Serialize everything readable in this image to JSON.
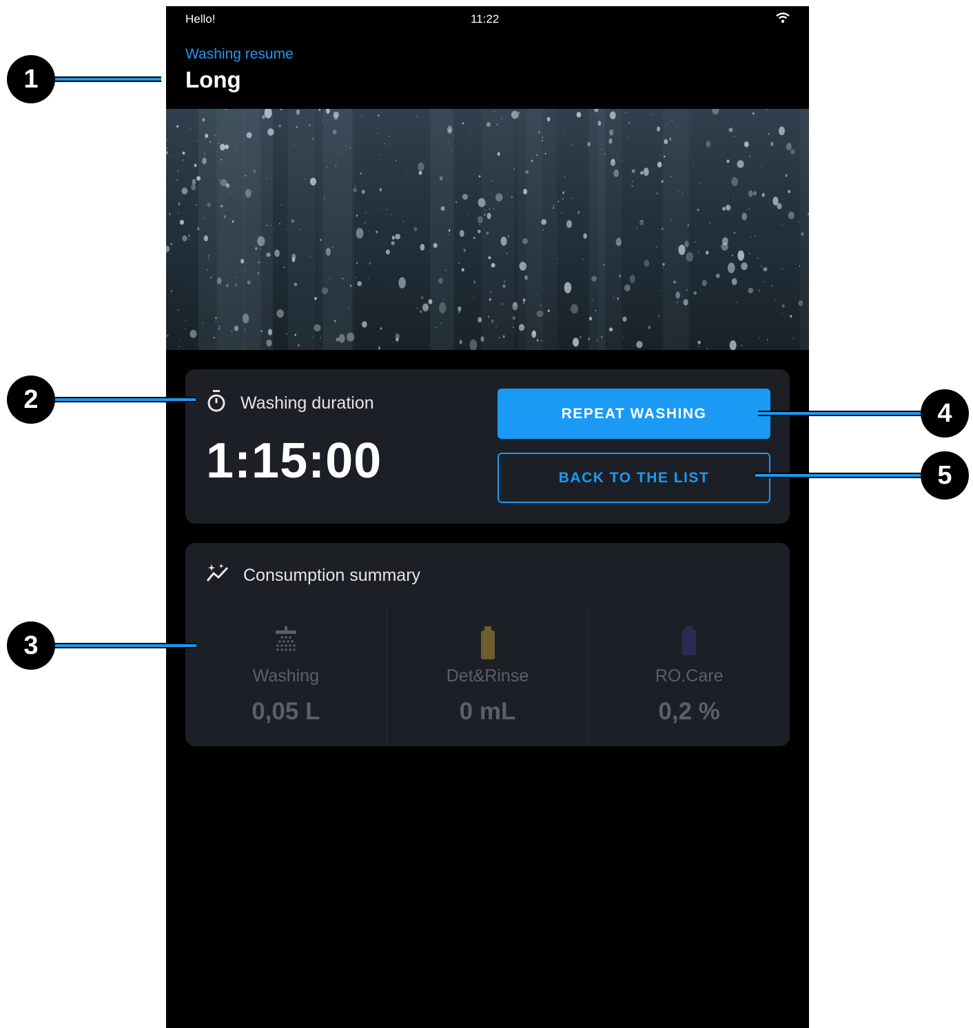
{
  "status_bar": {
    "greeting": "Hello!",
    "time": "11:22",
    "wifi_icon": "wifi-icon"
  },
  "header": {
    "subtitle": "Washing resume",
    "title": "Long"
  },
  "hero": {
    "image": "water-droplets-photo"
  },
  "duration_card": {
    "icon": "stopwatch-icon",
    "label": "Washing duration",
    "value": "1:15:00",
    "repeat_button": "REPEAT WASHING",
    "back_button": "BACK TO THE LIST"
  },
  "consumption_card": {
    "icon": "sparkle-chart-icon",
    "label": "Consumption summary",
    "items": [
      {
        "label": "Washing",
        "value": "0,05 L",
        "icon": "shower-icon",
        "color": "#5b6068"
      },
      {
        "label": "Det&Rinse",
        "value": "0 mL",
        "icon": "bottle-icon",
        "color": "#6e5e2e"
      },
      {
        "label": "RO.Care",
        "value": "0,2 %",
        "icon": "bottle-icon",
        "color": "#2b2b52"
      }
    ]
  },
  "callouts": [
    "1",
    "2",
    "3",
    "4",
    "5"
  ],
  "colors": {
    "accent": "#1a9af5",
    "card": "#1c2026",
    "background": "#000000"
  }
}
